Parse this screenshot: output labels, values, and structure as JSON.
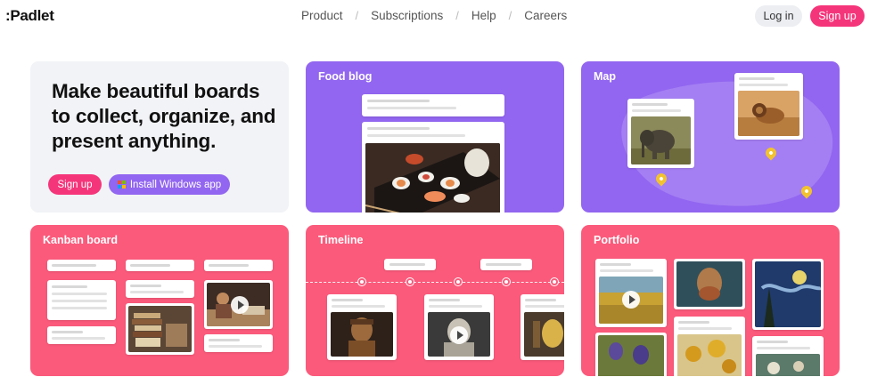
{
  "header": {
    "logo": ":Padlet",
    "nav": [
      "Product",
      "Subscriptions",
      "Help",
      "Careers"
    ],
    "nav_separator": "/",
    "login_label": "Log in",
    "signup_label": "Sign up"
  },
  "hero": {
    "title": "Make beautiful boards to collect, organize, and present anything.",
    "signup_label": "Sign up",
    "install_label": "Install Windows app",
    "install_icon": "windows-logo-icon"
  },
  "cards": {
    "food_blog": {
      "title": "Food blog"
    },
    "map": {
      "title": "Map"
    },
    "kanban": {
      "title": "Kanban board"
    },
    "timeline": {
      "title": "Timeline"
    },
    "portfolio": {
      "title": "Portfolio"
    }
  },
  "colors": {
    "brand_pink": "#f5357a",
    "card_purple": "#9266f0",
    "card_pink": "#fb5a7b",
    "hero_bg": "#f2f3f6",
    "pin_yellow": "#f2c22f"
  }
}
